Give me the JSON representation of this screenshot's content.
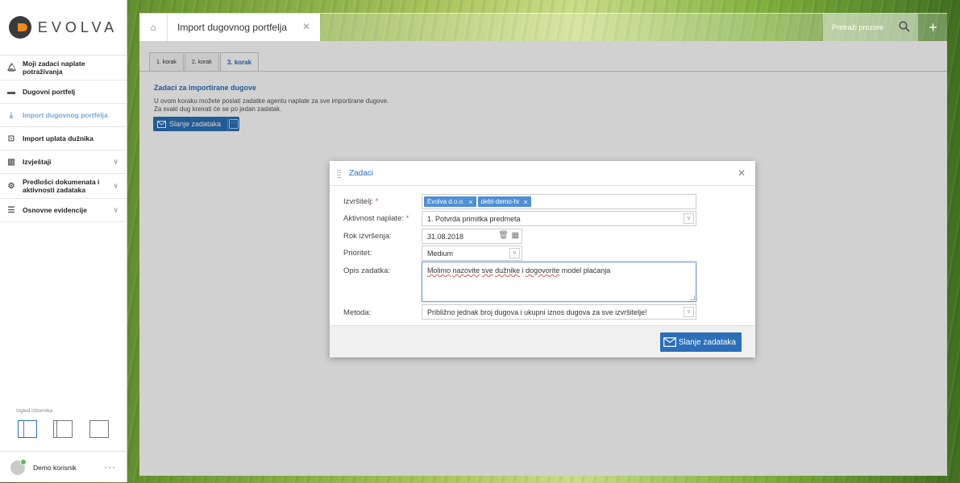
{
  "brand": {
    "name": "EVOLVA"
  },
  "sidebar": {
    "items": [
      {
        "label": "Moji zadaci naplate potraživanja",
        "icon": "bell-icon"
      },
      {
        "label": "Dugovni portfelj",
        "icon": "briefcase-icon"
      },
      {
        "label": "Import dugovnog portfelja",
        "icon": "download-icon",
        "active": true
      },
      {
        "label": "Import uplata dužnika",
        "icon": "money-icon"
      },
      {
        "label": "Izvještaji",
        "icon": "bar-chart-icon",
        "expandable": true
      },
      {
        "label": "Predlošci dokumenata i aktivnosti zadataka",
        "icon": "gear-icon",
        "expandable": true
      },
      {
        "label": "Osnovne evidencije",
        "icon": "list-icon",
        "expandable": true
      }
    ],
    "layout_label": "Izgled izbornika"
  },
  "user": {
    "name": "Demo korisnik",
    "more": "···"
  },
  "tabbar": {
    "tab_title": "Import dugovnog portfelja",
    "search_placeholder": "Pretraži prozore"
  },
  "wizard": {
    "steps": [
      "1. korak",
      "2. korak",
      "3. korak"
    ],
    "active_step": 3,
    "title": "Zadaci za importirane dugove",
    "desc_line1": "U ovom koraku možete poslati zadatke agentu naplate za sve importirane dugove.",
    "desc_line2": "Za svaki dug kreirati će se po jedan zadatak.",
    "send_button": "Slanje zadataka"
  },
  "modal": {
    "title": "Zadaci",
    "fields": {
      "izvrsitelj_label": "Izvršitelj:",
      "izvrsitelj_tags": [
        "Evolva d.o.o.",
        "debt-demo-hr"
      ],
      "aktivnost_label": "Aktivnost naplate:",
      "aktivnost_value": "1. Potvrda primitka predmeta",
      "rok_label": "Rok izvršenja:",
      "rok_value": "31.08.2018",
      "prioritet_label": "Prioritet:",
      "prioritet_value": "Medium",
      "opis_label": "Opis zadatka:",
      "opis_value_parts": [
        "Molimo",
        "nazovite",
        "sve",
        "dužnike",
        "i",
        "dogovorite",
        "model plaćanja"
      ],
      "metoda_label": "Metoda:",
      "metoda_value": "Približno jednak broj dugova i ukupni iznos dugova za sve izvršitelje!"
    },
    "required_mark": "*",
    "submit_label": "Slanje zadataka"
  },
  "colors": {
    "accent": "#2a6fb8",
    "tag": "#4f8fd4",
    "logo_orange": "#f08a1c"
  }
}
